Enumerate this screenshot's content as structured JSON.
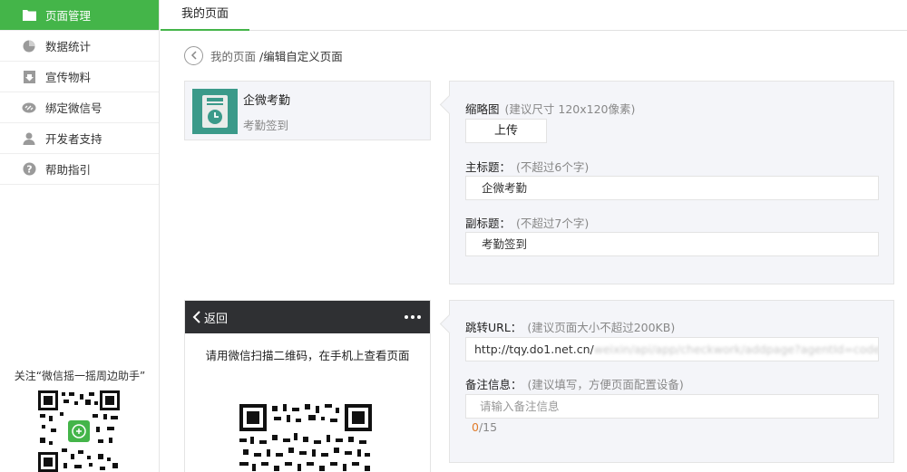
{
  "sidebar": {
    "items": [
      {
        "label": "页面管理",
        "icon": "folder-icon",
        "active": true
      },
      {
        "label": "数据统计",
        "icon": "pie-chart-icon"
      },
      {
        "label": "宣传物料",
        "icon": "download-icon"
      },
      {
        "label": "绑定微信号",
        "icon": "link-icon"
      },
      {
        "label": "开发者支持",
        "icon": "person-icon"
      },
      {
        "label": "帮助指引",
        "icon": "question-icon"
      }
    ],
    "follow_text": "关注“微信摇一摇周边助手”"
  },
  "header": {
    "tab_label": "我的页面"
  },
  "breadcrumb": {
    "parent": "我的页面",
    "current": "/编辑自定义页面"
  },
  "preview": {
    "title": "企微考勤",
    "subtitle": "考勤签到"
  },
  "form": {
    "thumbnail_label": "缩略图",
    "thumbnail_hint": "(建议尺寸 120x120像素)",
    "upload_label": "上传",
    "main_title_label": "主标题：",
    "main_title_hint": "(不超过6个字)",
    "main_title_value": "企微考勤",
    "sub_title_label": "副标题：",
    "sub_title_hint": "(不超过7个字)",
    "sub_title_value": "考勤签到",
    "url_label": "跳转URL：",
    "url_hint": "(建议页面大小不超过200KB)",
    "url_value": "http://tqy.do1.net.cn/",
    "url_value_obscured": "weixin/api/app/checkwork/addpage?agentId=code=client",
    "note_label": "备注信息：",
    "note_hint": "(建议填写，方便页面配置设备)",
    "note_placeholder": "请输入备注信息",
    "note_count": "0",
    "note_max": "/15"
  },
  "phone": {
    "back_label": "返回",
    "scan_message": "请用微信扫描二维码，在手机上查看页面"
  },
  "colors": {
    "accent": "#44b549",
    "panel_bg": "#f4f5f9",
    "phone_bar": "#2f3033",
    "thumb_bg": "#3b9a8a"
  }
}
